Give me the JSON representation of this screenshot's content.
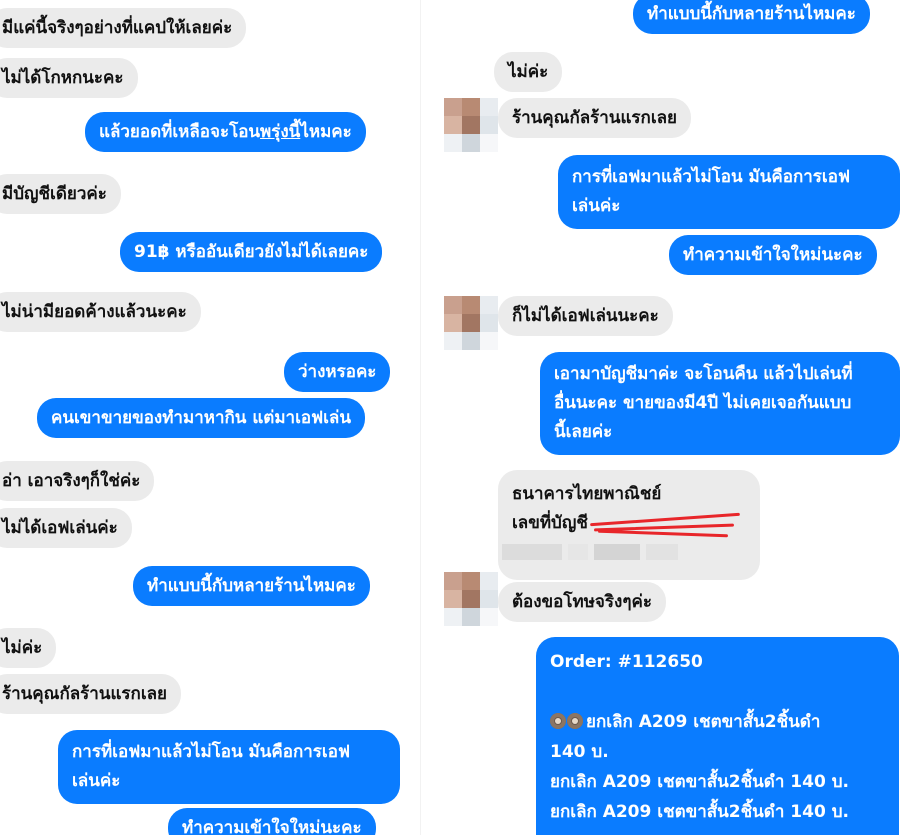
{
  "left_column": {
    "msg1": "มีแค่นี้จริงๆอย่างที่แคปให้เลยค่ะ",
    "msg2": "ไม่ได้โกหกนะคะ",
    "msg3_pre": "แล้วยอดที่เหลือจะโอน",
    "msg3_ul": "พรุ่งนี้",
    "msg3_post": "ไหมคะ",
    "msg4": "มีบัญชีเดียวค่ะ",
    "msg5": "91฿ หรืออันเดียวยังไม่ได้เลยคะ",
    "msg6": "ไม่น่ามียอดค้างแล้วนะคะ",
    "msg7": "ว่างหรอคะ",
    "msg8": "คนเขาขายของทำมาหากิน แต่มาเอฟเล่น",
    "msg9": "อ่า เอาจริงๆก็ใช่ค่ะ",
    "msg10": "ไม่ได้เอฟเล่นค่ะ",
    "msg11": "ทำแบบนี้กับหลายร้านไหมคะ",
    "msg12": "ไม่ค่ะ",
    "msg13": "ร้านคุณกัลร้านแรกเลย",
    "msg14_line1": "การที่เอฟมาแล้วไม่โอน มันคือการเอฟ",
    "msg14_line2": "เล่นค่ะ",
    "msg15": "ทำความเข้าใจใหม่นะคะ"
  },
  "right_column": {
    "msg1": "ทำแบบนี้กับหลายร้านไหมคะ",
    "msg2": "ไม่ค่ะ",
    "msg3": "ร้านคุณกัลร้านแรกเลย",
    "msg4_line1": "การที่เอฟมาแล้วไม่โอน มันคือการเอฟ",
    "msg4_line2": "เล่นค่ะ",
    "msg5": "ทำความเข้าใจใหม่นะคะ",
    "msg6": "ก็ไม่ได้เอฟเล่นนะคะ",
    "msg7_line1": "เอามาบัญชีมาค่ะ จะโอนคืน แล้วไปเล่นที่",
    "msg7_line2": "อื่นนะคะ ขายของมี4ปี ไม่เคยเจอกันแบบ",
    "msg7_line3": "นี้เลยค่ะ",
    "bank_name": "ธนาคารไทยพาณิชย์",
    "bank_account_label": "เลขที่บัญชี",
    "msg8": "ต้องขอโทษจริงๆค่ะ",
    "order_title": "Order: #112650",
    "order_line1": "ยกเลิก A209 เชตขาสั้น2ชิ้นดำ",
    "order_line1b": "140 บ.",
    "order_line2": "ยกเลิก A209 เชตขาสั้น2ชิ้นดำ  140 บ.",
    "order_line3": "ยกเลิก A209 เชตขาสั้น2ชิ้นดำ  140 บ."
  },
  "colors": {
    "outgoing_bubble": "#0a7cff",
    "incoming_bubble": "#ebebeb",
    "redaction_scribble": "#e8262a"
  }
}
